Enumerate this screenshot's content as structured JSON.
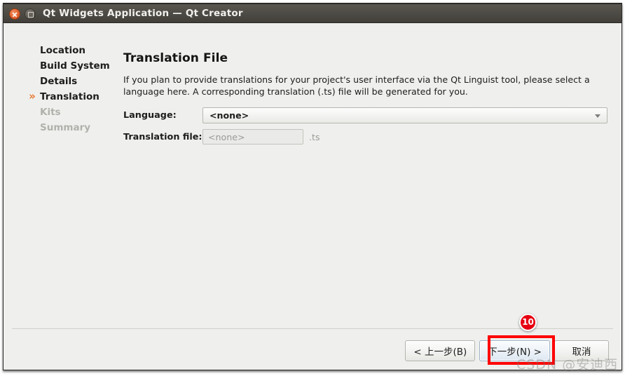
{
  "window": {
    "title": "Qt Widgets Application — Qt Creator",
    "close_icon": "close-icon",
    "maximize_icon": "maximize-icon"
  },
  "sidebar": {
    "items": [
      {
        "label": "Location",
        "state": "done",
        "marker": ""
      },
      {
        "label": "Build System",
        "state": "done",
        "marker": ""
      },
      {
        "label": "Details",
        "state": "done",
        "marker": ""
      },
      {
        "label": "Translation",
        "state": "current",
        "marker": "»"
      },
      {
        "label": "Kits",
        "state": "pending",
        "marker": ""
      },
      {
        "label": "Summary",
        "state": "pending",
        "marker": ""
      }
    ]
  },
  "main": {
    "title": "Translation File",
    "description": "If you plan to provide translations for your project's user interface via the Qt Linguist tool, please select a language here. A corresponding translation (.ts) file will be generated for you.",
    "fields": {
      "language": {
        "label": "Language:",
        "value": "<none>",
        "arrow_icon": "chevron-down-icon"
      },
      "translation_file": {
        "label": "Translation file:",
        "placeholder": "<none>",
        "value": "<none>",
        "suffix": ".ts"
      }
    }
  },
  "footer": {
    "back_label": "< 上一步(B)",
    "next_label": "下一步(N) >",
    "cancel_label": "取消"
  },
  "annotation": {
    "badge_number": "10",
    "highlight_color": "#ff0000",
    "badge_color": "#e60012"
  },
  "watermark": {
    "text": "CSDN @安迪西"
  }
}
